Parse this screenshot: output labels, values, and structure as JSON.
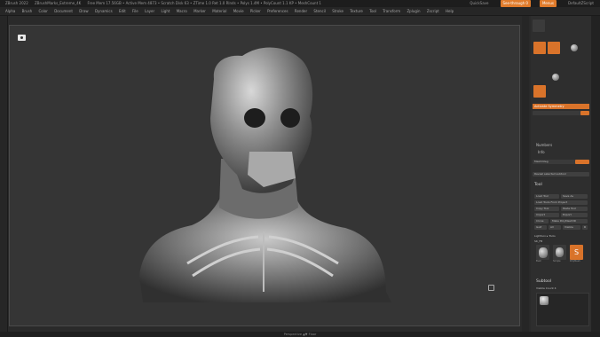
{
  "titlebar": {
    "app": "ZBrush 2022",
    "project": "ZBrushMarks_Extreme_4K",
    "info": "Free Mem 17.56GB • Active Mem 4873 • Scratch Disk 63 • ZTime 1.0 Ret 1.0 Rlnds • Polys 1.4M • PolyCount 1.1 KP • MeshCount 1",
    "buttons": [
      "QuickSave",
      "See-through 0",
      "Menus",
      "DefaultZScript"
    ]
  },
  "menubar": {
    "items": [
      "Alpha",
      "Brush",
      "Color",
      "Document",
      "Draw",
      "Dynamics",
      "Edit",
      "File",
      "Layer",
      "Light",
      "Macro",
      "Marker",
      "Material",
      "Movie",
      "Picker",
      "Preferences",
      "Render",
      "Stencil",
      "Stroke",
      "Texture",
      "Tool",
      "Transform",
      "Zplugin",
      "Zscript",
      "Help"
    ]
  },
  "canvas": {
    "bottom_label": "Perspective ▲▼ Floor"
  },
  "right_panel": {
    "activate_symmetry": "Activate Symmetry",
    "numbers_label": "Numbers",
    "info_label": "Info",
    "morph_label": "MeshInteg",
    "reveal_label": "Reveal selected subtool",
    "tool_header": "Tool",
    "tool_buttons": [
      "Load Tool",
      "Save As",
      "Load Tools From Project",
      "Copy Tool",
      "Paste Tool",
      "Import",
      "Export",
      "Clone",
      "Make PolyMesh3D",
      "GoZ",
      "All",
      "Visible",
      "R"
    ],
    "lightbox_label": "Lightbox ▸ Tools",
    "subtool_count": "SK_FB",
    "thumb_captions": [
      "Bust",
      "Simple",
      "PolyMesh"
    ],
    "subtool_header": "Subtool",
    "visible_count": "Visible Count 4"
  },
  "colors": {
    "accent": "#d9732a",
    "canvas_bg": "#353535",
    "ui_bg": "#2a2a2a"
  }
}
